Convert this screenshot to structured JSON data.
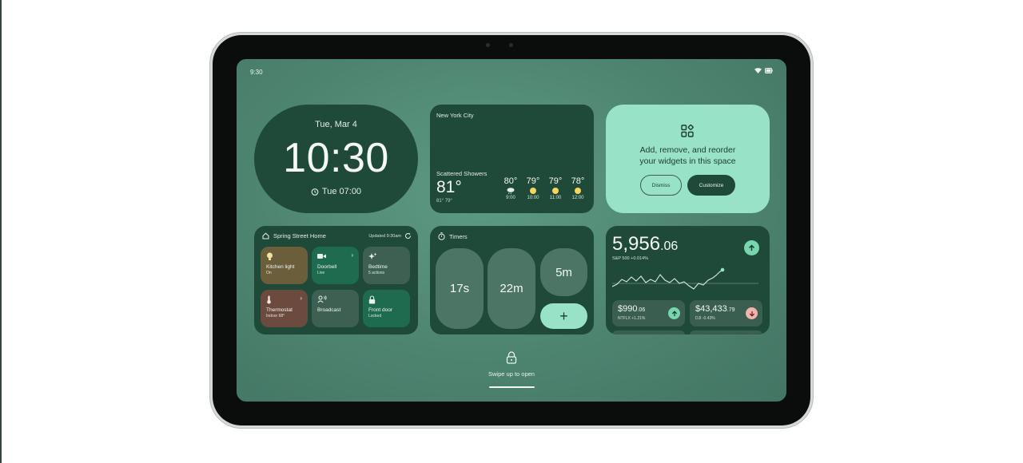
{
  "status": {
    "time": "9:30"
  },
  "clock": {
    "date": "Tue, Mar 4",
    "time": "10:30",
    "alarm": "Tue 07:00"
  },
  "weather": {
    "city": "New York City",
    "condition": "Scattered Showers",
    "temp": "81°",
    "hilo": "81° 79°",
    "hours": [
      {
        "temp": "80°",
        "time": "9:00",
        "icon": "rain-cloud-icon"
      },
      {
        "temp": "79°",
        "time": "10:00",
        "icon": "sun-icon"
      },
      {
        "temp": "79°",
        "time": "11:00",
        "icon": "sun-icon"
      },
      {
        "temp": "78°",
        "time": "12:00",
        "icon": "sun-icon"
      }
    ]
  },
  "customize": {
    "line1": "Add, remove, and reorder",
    "line2": "your widgets in this space",
    "dismiss": "Dismiss",
    "customize": "Customize"
  },
  "home": {
    "title": "Spring Street Home",
    "updated": "Updated 9:30am",
    "tiles": [
      {
        "label": "Kitchen light",
        "sub": "On"
      },
      {
        "label": "Doorbell",
        "sub": "Live"
      },
      {
        "label": "Bedtime",
        "sub": "5 actions"
      },
      {
        "label": "Thermostat",
        "sub": "Indoor 68°"
      },
      {
        "label": "Broadcast",
        "sub": ""
      },
      {
        "label": "Front door",
        "sub": "Locked"
      }
    ]
  },
  "timers": {
    "title": "Timers",
    "items": [
      "17s",
      "22m",
      "5m"
    ],
    "add": "+"
  },
  "stocks": {
    "value": "5,956",
    "decimals": ".06",
    "sub": "S&P 500 +0.014%",
    "tickers": [
      {
        "price": "$990",
        "cents": ".06",
        "sub": "NTFLX +1.21%",
        "trend": "up"
      },
      {
        "price": "$43,433",
        "cents": ".79",
        "sub": "DJI -0.43%",
        "trend": "down"
      }
    ]
  },
  "lock": {
    "text": "Swipe up to open"
  },
  "colors": {
    "screen_bg": "#4d8470",
    "card": "#1f4a3a",
    "accent": "#98e3c7",
    "positive": "#78d6ae",
    "negative": "#f3b3ad"
  }
}
